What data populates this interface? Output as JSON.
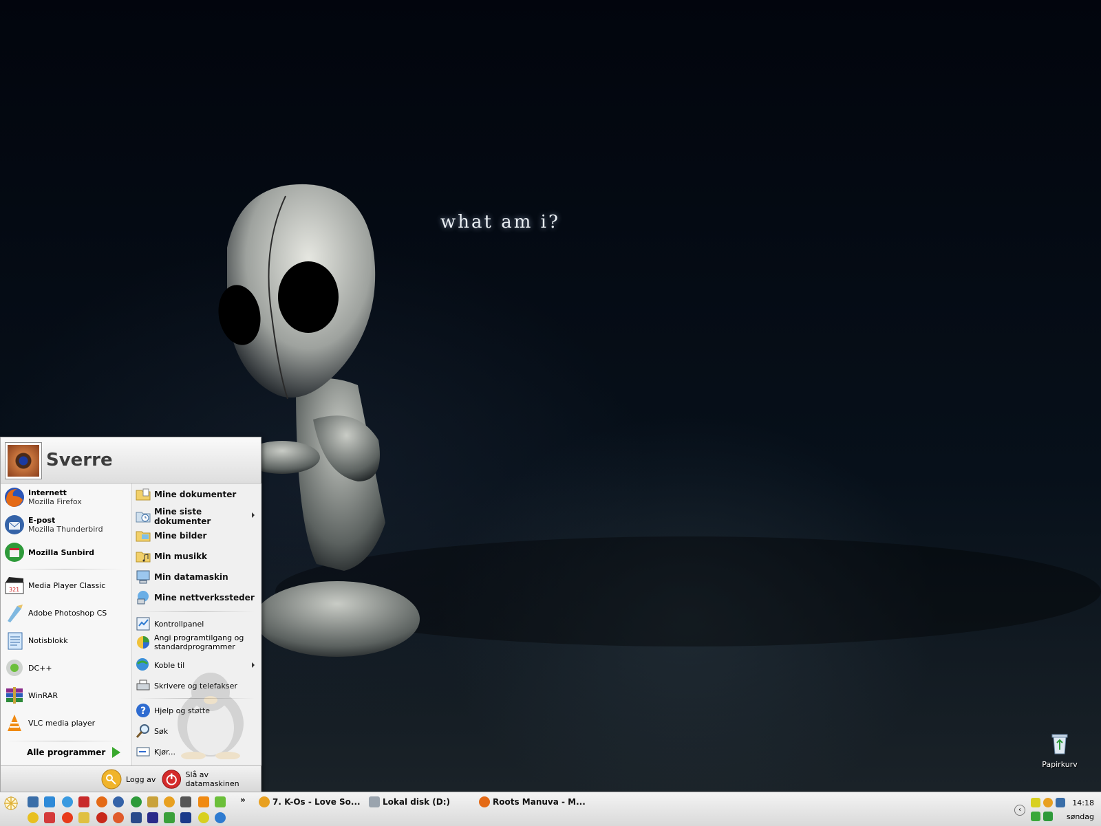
{
  "wallpaper": {
    "caption": "what am i?"
  },
  "desktop_icons": [
    {
      "label": "Papirkurv",
      "icon": "recycle-bin-icon"
    }
  ],
  "start_menu": {
    "user": "Sverre",
    "pinned": [
      {
        "title": "Internett",
        "subtitle": "Mozilla Firefox",
        "icon": "firefox-icon"
      },
      {
        "title": "E-post",
        "subtitle": "Mozilla Thunderbird",
        "icon": "thunderbird-icon"
      },
      {
        "title": "Mozilla Sunbird",
        "subtitle": "",
        "icon": "sunbird-icon"
      }
    ],
    "recent": [
      {
        "label": "Media Player Classic",
        "icon": "media-player-classic-icon"
      },
      {
        "label": "Adobe Photoshop CS",
        "icon": "photoshop-icon"
      },
      {
        "label": "Notisblokk",
        "icon": "notepad-icon"
      },
      {
        "label": "DC++",
        "icon": "dcplusplus-icon"
      },
      {
        "label": "WinRAR",
        "icon": "winrar-icon"
      },
      {
        "label": "VLC media player",
        "icon": "vlc-icon"
      }
    ],
    "all_programs": "Alle programmer",
    "places": [
      {
        "label": "Mine dokumenter",
        "icon": "folder-documents-icon"
      },
      {
        "label": "Mine siste dokumenter",
        "icon": "folder-recent-icon"
      },
      {
        "label": "Mine bilder",
        "icon": "folder-pictures-icon"
      },
      {
        "label": "Min musikk",
        "icon": "folder-music-icon"
      },
      {
        "label": "Min datamaskin",
        "icon": "my-computer-icon"
      },
      {
        "label": "Mine nettverkssteder",
        "icon": "network-places-icon"
      }
    ],
    "settings": [
      {
        "label": "Kontrollpanel",
        "icon": "control-panel-icon"
      },
      {
        "label": "Angi programtilgang og",
        "label2": "standardprogrammer",
        "icon": "program-access-icon"
      },
      {
        "label": "Koble til",
        "icon": "connect-icon"
      },
      {
        "label": "Skrivere og telefakser",
        "icon": "printer-icon"
      }
    ],
    "tools": [
      {
        "label": "Hjelp og støtte",
        "icon": "help-icon"
      },
      {
        "label": "Søk",
        "icon": "search-icon"
      },
      {
        "label": "Kjør...",
        "icon": "run-icon"
      }
    ],
    "footer": {
      "logoff": "Logg av",
      "shutdown": "Slå av datamaskinen"
    }
  },
  "taskbar": {
    "more": "»",
    "tasks": [
      {
        "label": "7. K-Os - Love So...",
        "icon": "winamp-icon"
      },
      {
        "label": "Lokal disk (D:)",
        "icon": "drive-icon"
      },
      {
        "label": "Roots Manuva - M...",
        "icon": "firefox-icon"
      }
    ],
    "clock": {
      "time": "14:18",
      "day": "søndag"
    }
  }
}
